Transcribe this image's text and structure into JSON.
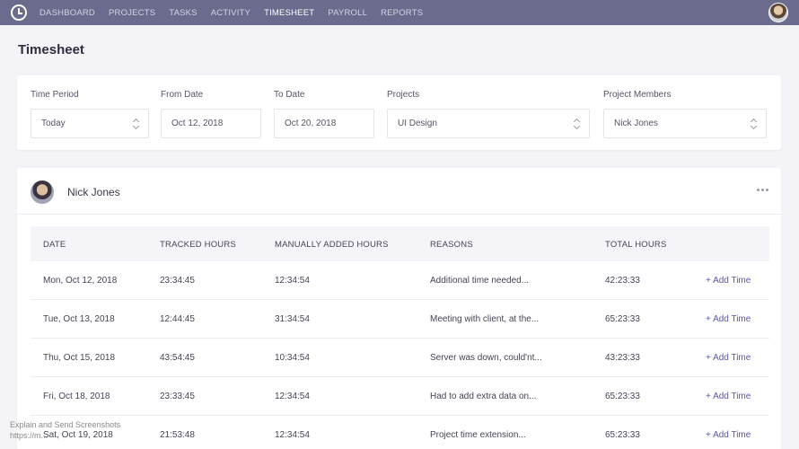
{
  "nav": {
    "logo_icon": "clock-icon",
    "items": [
      "DASHBOARD",
      "PROJECTS",
      "TASKS",
      "ACTIVITY",
      "TIMESHEET",
      "PAYROLL",
      "REPORTS"
    ],
    "active": "TIMESHEET"
  },
  "page": {
    "title": "Timesheet"
  },
  "filters": {
    "time_period": {
      "label": "Time Period",
      "value": "Today"
    },
    "from_date": {
      "label": "From Date",
      "value": "Oct 12, 2018"
    },
    "to_date": {
      "label": "To Date",
      "value": "Oct 20, 2018"
    },
    "projects": {
      "label": "Projects",
      "value": "UI Design"
    },
    "members": {
      "label": "Project Members",
      "value": "Nick Jones"
    }
  },
  "member": {
    "name": "Nick Jones"
  },
  "table": {
    "headers": [
      "DATE",
      "TRACKED HOURS",
      "MANUALLY ADDED HOURS",
      "REASONS",
      "TOTAL HOURS"
    ],
    "action_label": "+ Add Time",
    "rows": [
      {
        "date": "Mon, Oct 12, 2018",
        "tracked": "23:34:45",
        "manual": "12:34:54",
        "reason": "Additional time needed...",
        "total": "42:23:33"
      },
      {
        "date": "Tue, Oct 13, 2018",
        "tracked": "12:44:45",
        "manual": "31:34:54",
        "reason": "Meeting with client, at the...",
        "total": "65:23:33"
      },
      {
        "date": "Thu, Oct 15, 2018",
        "tracked": "43:54:45",
        "manual": "10:34:54",
        "reason": "Server was down, could'nt...",
        "total": "43:23:33"
      },
      {
        "date": "Fri, Oct 18, 2018",
        "tracked": "23:33:45",
        "manual": "12:34:54",
        "reason": "Had to add extra data on...",
        "total": "65:23:33"
      },
      {
        "date": "Sat, Oct 19, 2018",
        "tracked": "21:53:48",
        "manual": "12:34:54",
        "reason": "Project time extension...",
        "total": "65:23:33"
      }
    ]
  },
  "watermark": {
    "line1": "Explain and Send Screenshots",
    "line2": "https://m..."
  }
}
